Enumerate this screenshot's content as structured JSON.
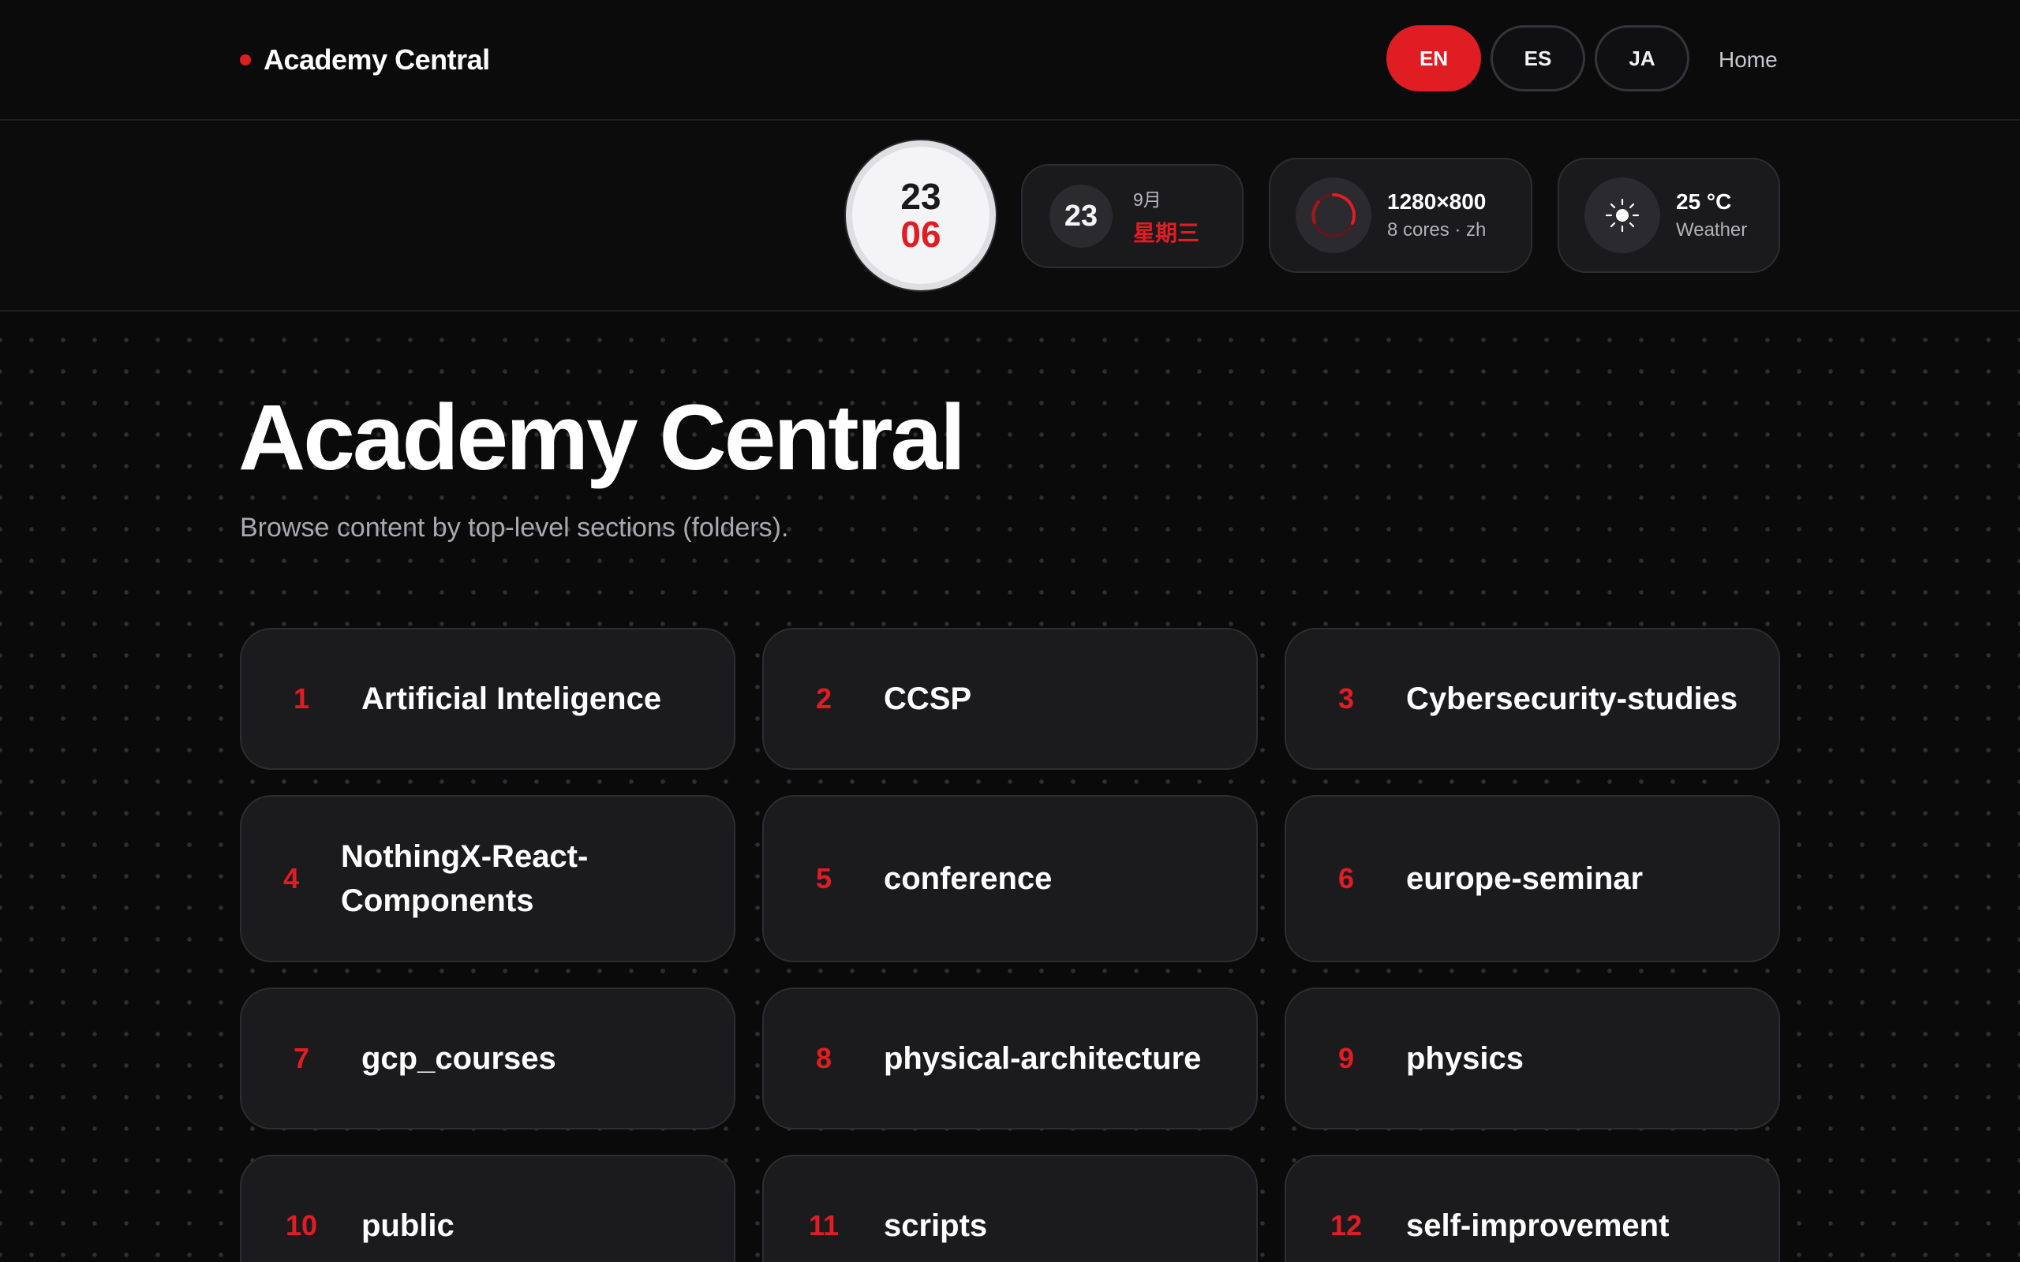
{
  "header": {
    "brand": "Academy Central",
    "languages": [
      {
        "code": "EN",
        "active": true
      },
      {
        "code": "ES",
        "active": false
      },
      {
        "code": "JA",
        "active": false
      }
    ],
    "home_label": "Home"
  },
  "widgets": {
    "clock": {
      "hour": "23",
      "minute": "06"
    },
    "date": {
      "day": "23",
      "month": "9月",
      "weekday": "星期三"
    },
    "system": {
      "resolution": "1280×800",
      "detail": "8 cores · zh",
      "icon": "spinner-icon"
    },
    "weather": {
      "temperature": "25 °C",
      "label": "Weather",
      "icon": "sun-icon"
    }
  },
  "main": {
    "title": "Academy Central",
    "subtitle": "Browse content by top-level sections (folders).",
    "sections": [
      {
        "num": "1",
        "title": "Artificial Inteligence"
      },
      {
        "num": "2",
        "title": "CCSP"
      },
      {
        "num": "3",
        "title": "Cybersecurity-studies"
      },
      {
        "num": "4",
        "title": "NothingX-React-Components"
      },
      {
        "num": "5",
        "title": "conference"
      },
      {
        "num": "6",
        "title": "europe-seminar"
      },
      {
        "num": "7",
        "title": "gcp_courses"
      },
      {
        "num": "8",
        "title": "physical-architecture"
      },
      {
        "num": "9",
        "title": "physics"
      },
      {
        "num": "10",
        "title": "public"
      },
      {
        "num": "11",
        "title": "scripts"
      },
      {
        "num": "12",
        "title": "self-improvement"
      }
    ]
  },
  "colors": {
    "accent": "#e11d24",
    "background": "#0a0a0b",
    "card": "#1b1b1e"
  }
}
